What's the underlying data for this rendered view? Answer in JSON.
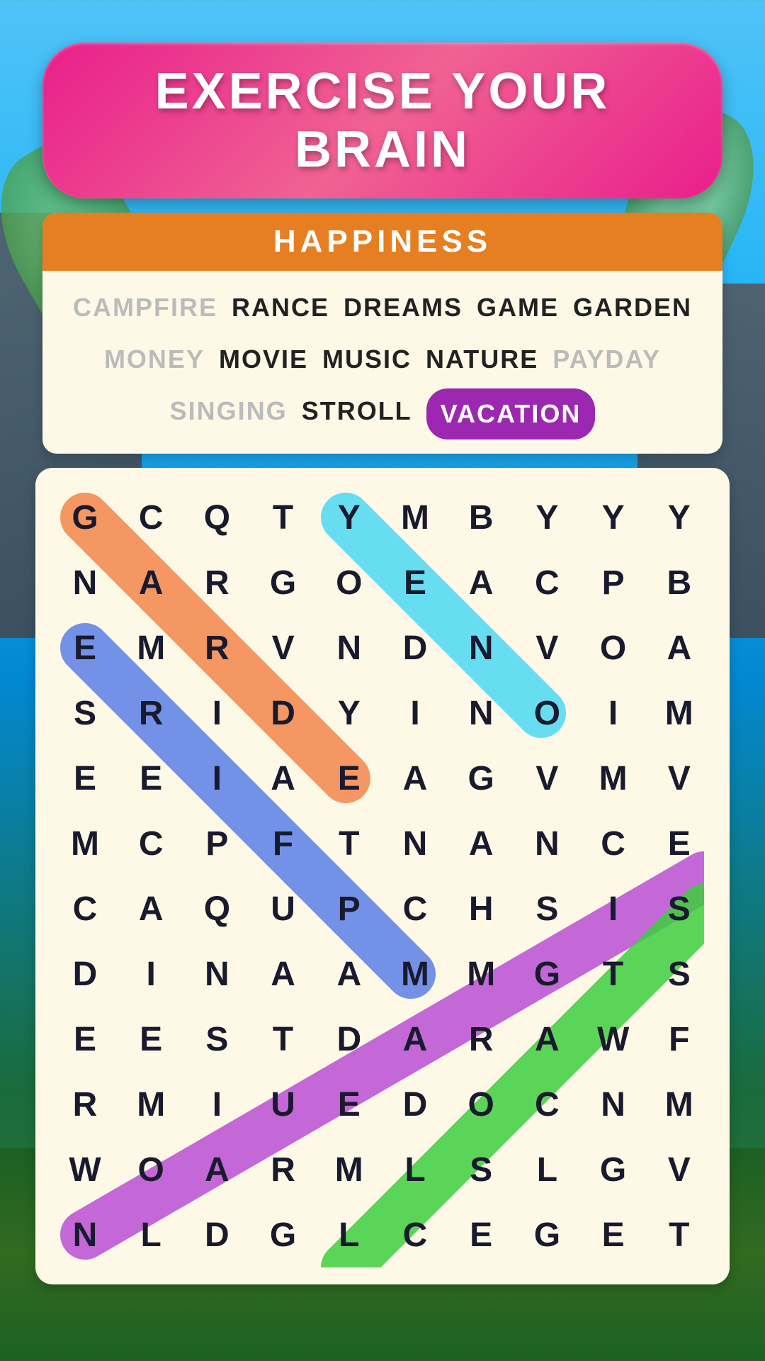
{
  "app": {
    "title": "EXERCISE YOUR BRAIN",
    "category": "HAPPINESS"
  },
  "words": [
    {
      "text": "CAMPFIRE",
      "state": "found"
    },
    {
      "text": "RANCE",
      "state": "normal"
    },
    {
      "text": "DREAMS",
      "state": "normal"
    },
    {
      "text": "GAME",
      "state": "normal"
    },
    {
      "text": "GARDEN",
      "state": "normal"
    },
    {
      "text": "MONEY",
      "state": "found"
    },
    {
      "text": "MOVIE",
      "state": "normal"
    },
    {
      "text": "MUSIC",
      "state": "normal"
    },
    {
      "text": "NATURE",
      "state": "normal"
    },
    {
      "text": "PAYDAY",
      "state": "found"
    },
    {
      "text": "SINGING",
      "state": "found"
    },
    {
      "text": "STROLL",
      "state": "normal"
    },
    {
      "text": "VACATION",
      "state": "highlighted"
    }
  ],
  "grid": [
    [
      "G",
      "C",
      "Q",
      "T",
      "Y",
      "M",
      "B",
      "Y",
      "Y",
      "Y"
    ],
    [
      "N",
      "A",
      "R",
      "G",
      "O",
      "E",
      "A",
      "C",
      "P",
      "B"
    ],
    [
      "E",
      "M",
      "R",
      "V",
      "N",
      "D",
      "N",
      "V",
      "O",
      "A"
    ],
    [
      "S",
      "R",
      "I",
      "D",
      "Y",
      "I",
      "N",
      "O",
      "I",
      "M"
    ],
    [
      "E",
      "E",
      "I",
      "A",
      "E",
      "A",
      "G",
      "V",
      "M",
      "V"
    ],
    [
      "M",
      "C",
      "P",
      "F",
      "T",
      "N",
      "A",
      "N",
      "C",
      "E"
    ],
    [
      "C",
      "A",
      "Q",
      "U",
      "P",
      "C",
      "H",
      "S",
      "I",
      "S"
    ],
    [
      "D",
      "I",
      "N",
      "A",
      "A",
      "M",
      "M",
      "G",
      "T",
      "S"
    ],
    [
      "E",
      "E",
      "S",
      "T",
      "D",
      "A",
      "R",
      "A",
      "W",
      "F"
    ],
    [
      "R",
      "M",
      "I",
      "U",
      "E",
      "D",
      "O",
      "C",
      "N",
      "M"
    ],
    [
      "W",
      "O",
      "A",
      "R",
      "M",
      "L",
      "S",
      "L",
      "G",
      "V"
    ],
    [
      "N",
      "L",
      "D",
      "G",
      "L",
      "C",
      "E",
      "G",
      "E",
      "T"
    ]
  ],
  "colors": {
    "orange_strip": "#f4874b",
    "blue_strip": "#5b7fe8",
    "cyan_strip": "#4dd9f5",
    "purple_strip": "#b94fd4",
    "green_strip": "#3ecf3e"
  }
}
